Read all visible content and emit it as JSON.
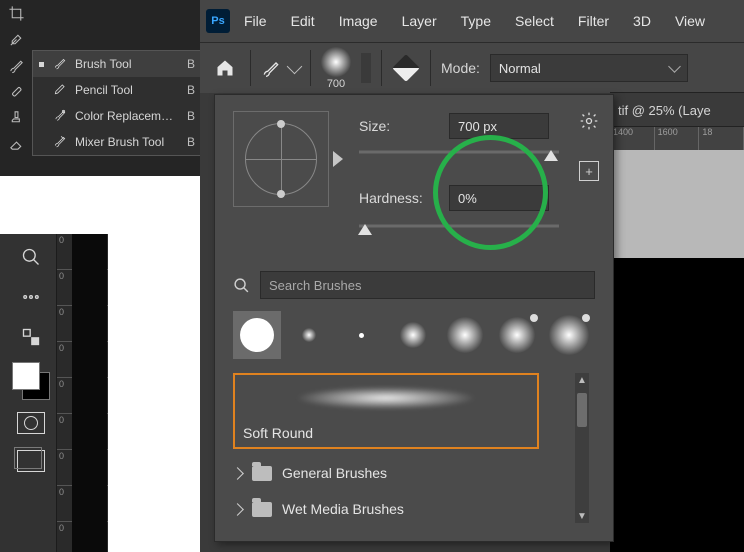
{
  "flyout": {
    "items": [
      {
        "label": "Brush Tool",
        "key": "B",
        "selected": true
      },
      {
        "label": "Pencil Tool",
        "key": "B",
        "selected": false
      },
      {
        "label": "Color Replacement Tool",
        "key": "B",
        "selected": false
      },
      {
        "label": "Mixer Brush Tool",
        "key": "B",
        "selected": false
      }
    ]
  },
  "menubar": [
    "File",
    "Edit",
    "Image",
    "Layer",
    "Type",
    "Select",
    "Filter",
    "3D",
    "View"
  ],
  "optbar": {
    "brush_size_preview": "700",
    "mode_label": "Mode:",
    "mode_value": "Normal"
  },
  "tab": {
    "title": "tif @ 25% (Laye"
  },
  "hruler_ticks": [
    "1400",
    "1600",
    "18"
  ],
  "pop": {
    "size_label": "Size:",
    "size_value": "700 px",
    "hardness_label": "Hardness:",
    "hardness_value": "0%",
    "search_placeholder": "Search Brushes",
    "preset_label": "Soft Round",
    "folders": [
      "General Brushes",
      "Wet Media Brushes"
    ]
  },
  "left_ruler_ticks": [
    "0",
    "0",
    "0",
    "0",
    "0",
    "0",
    "0",
    "0",
    "0"
  ]
}
